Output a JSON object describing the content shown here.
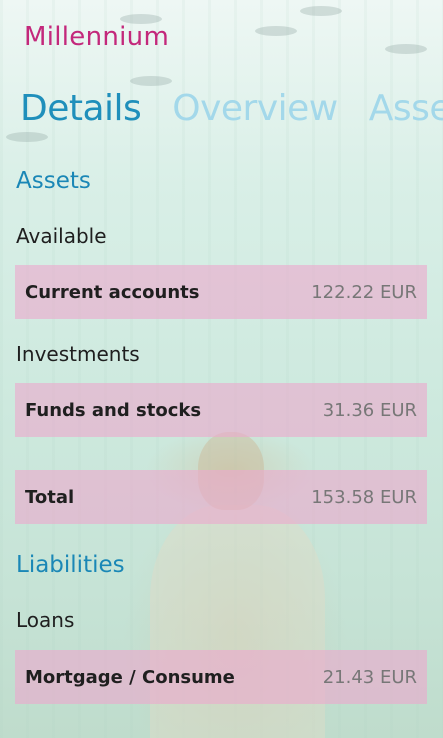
{
  "app": {
    "title": "Millennium"
  },
  "pivot": {
    "items": [
      "Details",
      "Overview",
      "Asse"
    ]
  },
  "assets": {
    "title": "Assets",
    "available_label": "Available",
    "current_accounts": {
      "label": "Current accounts",
      "value": "122.22 EUR"
    },
    "investments_label": "Investments",
    "funds_and_stocks": {
      "label": "Funds and stocks",
      "value": "31.36 EUR"
    },
    "total": {
      "label": "Total",
      "value": "153.58 EUR"
    }
  },
  "liabilities": {
    "title": "Liabilities",
    "loans_label": "Loans",
    "mortgage": {
      "label": "Mortgage / Consume",
      "value": "21.43 EUR"
    }
  },
  "colors": {
    "accent": "#1f8fbb",
    "brand": "#c3287b",
    "row_background": "#ecaacd"
  }
}
